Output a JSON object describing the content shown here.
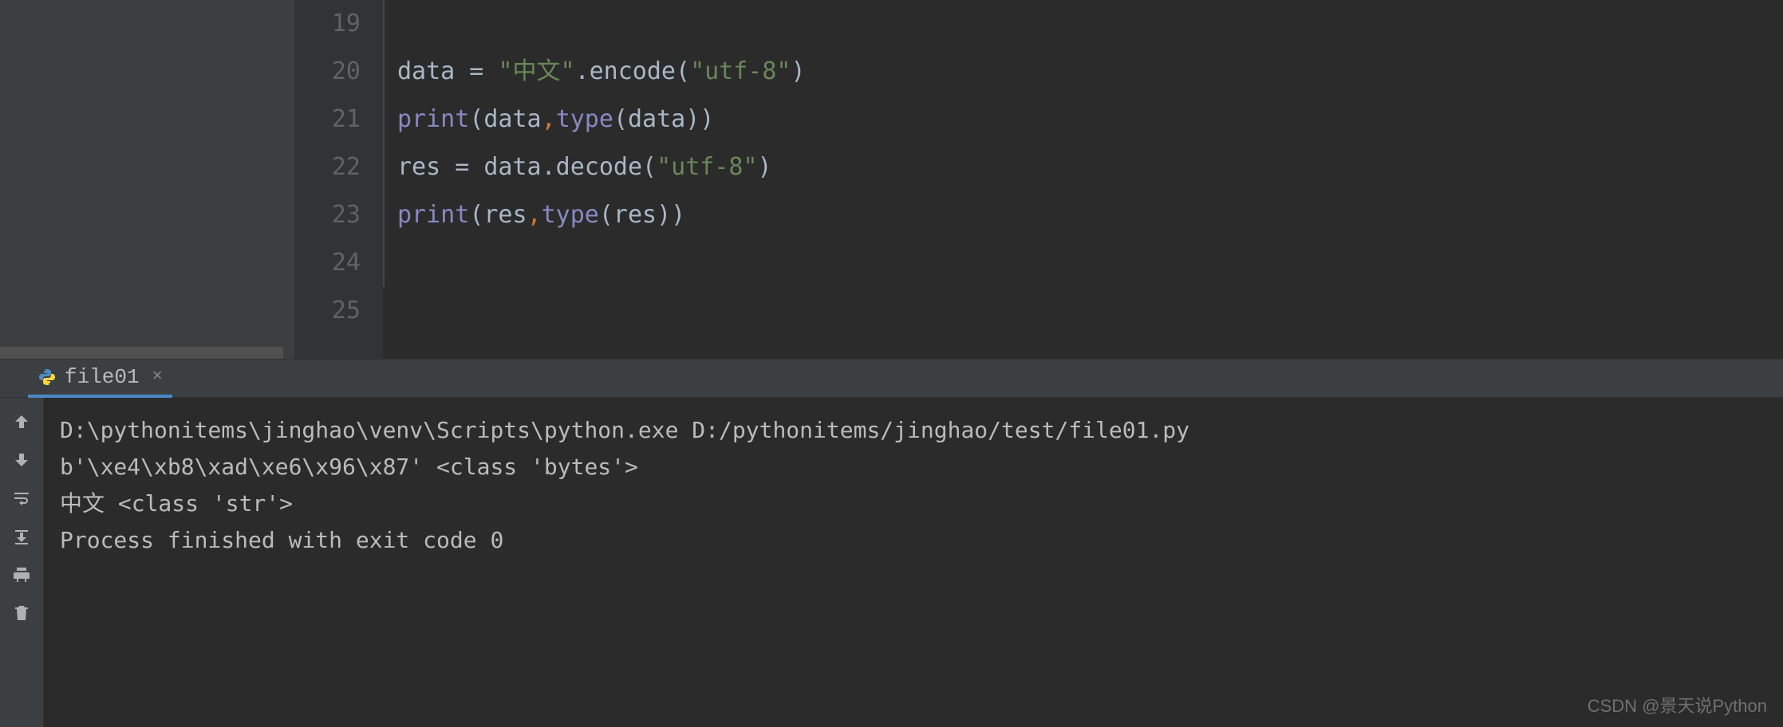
{
  "editor": {
    "gutter": [
      "19",
      "20",
      "21",
      "22",
      "23",
      "24",
      "25"
    ],
    "lines": {
      "l20": {
        "t1": "data = ",
        "s1": "\"中文\"",
        "t2": ".encode(",
        "s2": "\"utf-8\"",
        "t3": ")"
      },
      "l21": {
        "fn": "print",
        "t1": "(data",
        "comma": ",",
        "builtin": "type",
        "t2": "(data))"
      },
      "l22": {
        "t1": "res = data.decode(",
        "s1": "\"utf-8\"",
        "t2": ")"
      },
      "l23": {
        "fn": "print",
        "t1": "(res",
        "comma": ",",
        "builtin": "type",
        "t2": "(res))"
      }
    }
  },
  "run": {
    "tab_label": "file01",
    "output": {
      "l1": "D:\\pythonitems\\jinghao\\venv\\Scripts\\python.exe D:/pythonitems/jinghao/test/file01.py",
      "l2": "b'\\xe4\\xb8\\xad\\xe6\\x96\\x87' <class 'bytes'>",
      "l3": "中文 <class 'str'>",
      "l4": "",
      "l5": "Process finished with exit code 0"
    }
  },
  "watermark": "CSDN @景天说Python"
}
